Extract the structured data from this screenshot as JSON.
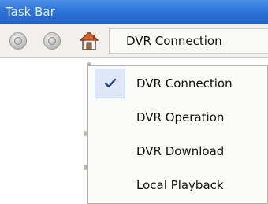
{
  "window": {
    "title": "Task Bar"
  },
  "toolbar": {
    "buttons": [
      {
        "icon": "disabled-round-icon"
      },
      {
        "icon": "disabled-round-icon"
      },
      {
        "icon": "home-icon"
      }
    ],
    "selector": {
      "value": "DVR Connection"
    }
  },
  "menu": {
    "items": [
      {
        "label": "DVR Connection",
        "checked": true
      },
      {
        "label": "DVR Operation",
        "checked": false
      },
      {
        "label": "DVR Download",
        "checked": false
      },
      {
        "label": "Local Playback",
        "checked": false
      }
    ]
  },
  "colors": {
    "titlebar": "#2a6fd6",
    "toolbar": "#f1f0ec",
    "menu_highlight": "#dde7f6"
  }
}
